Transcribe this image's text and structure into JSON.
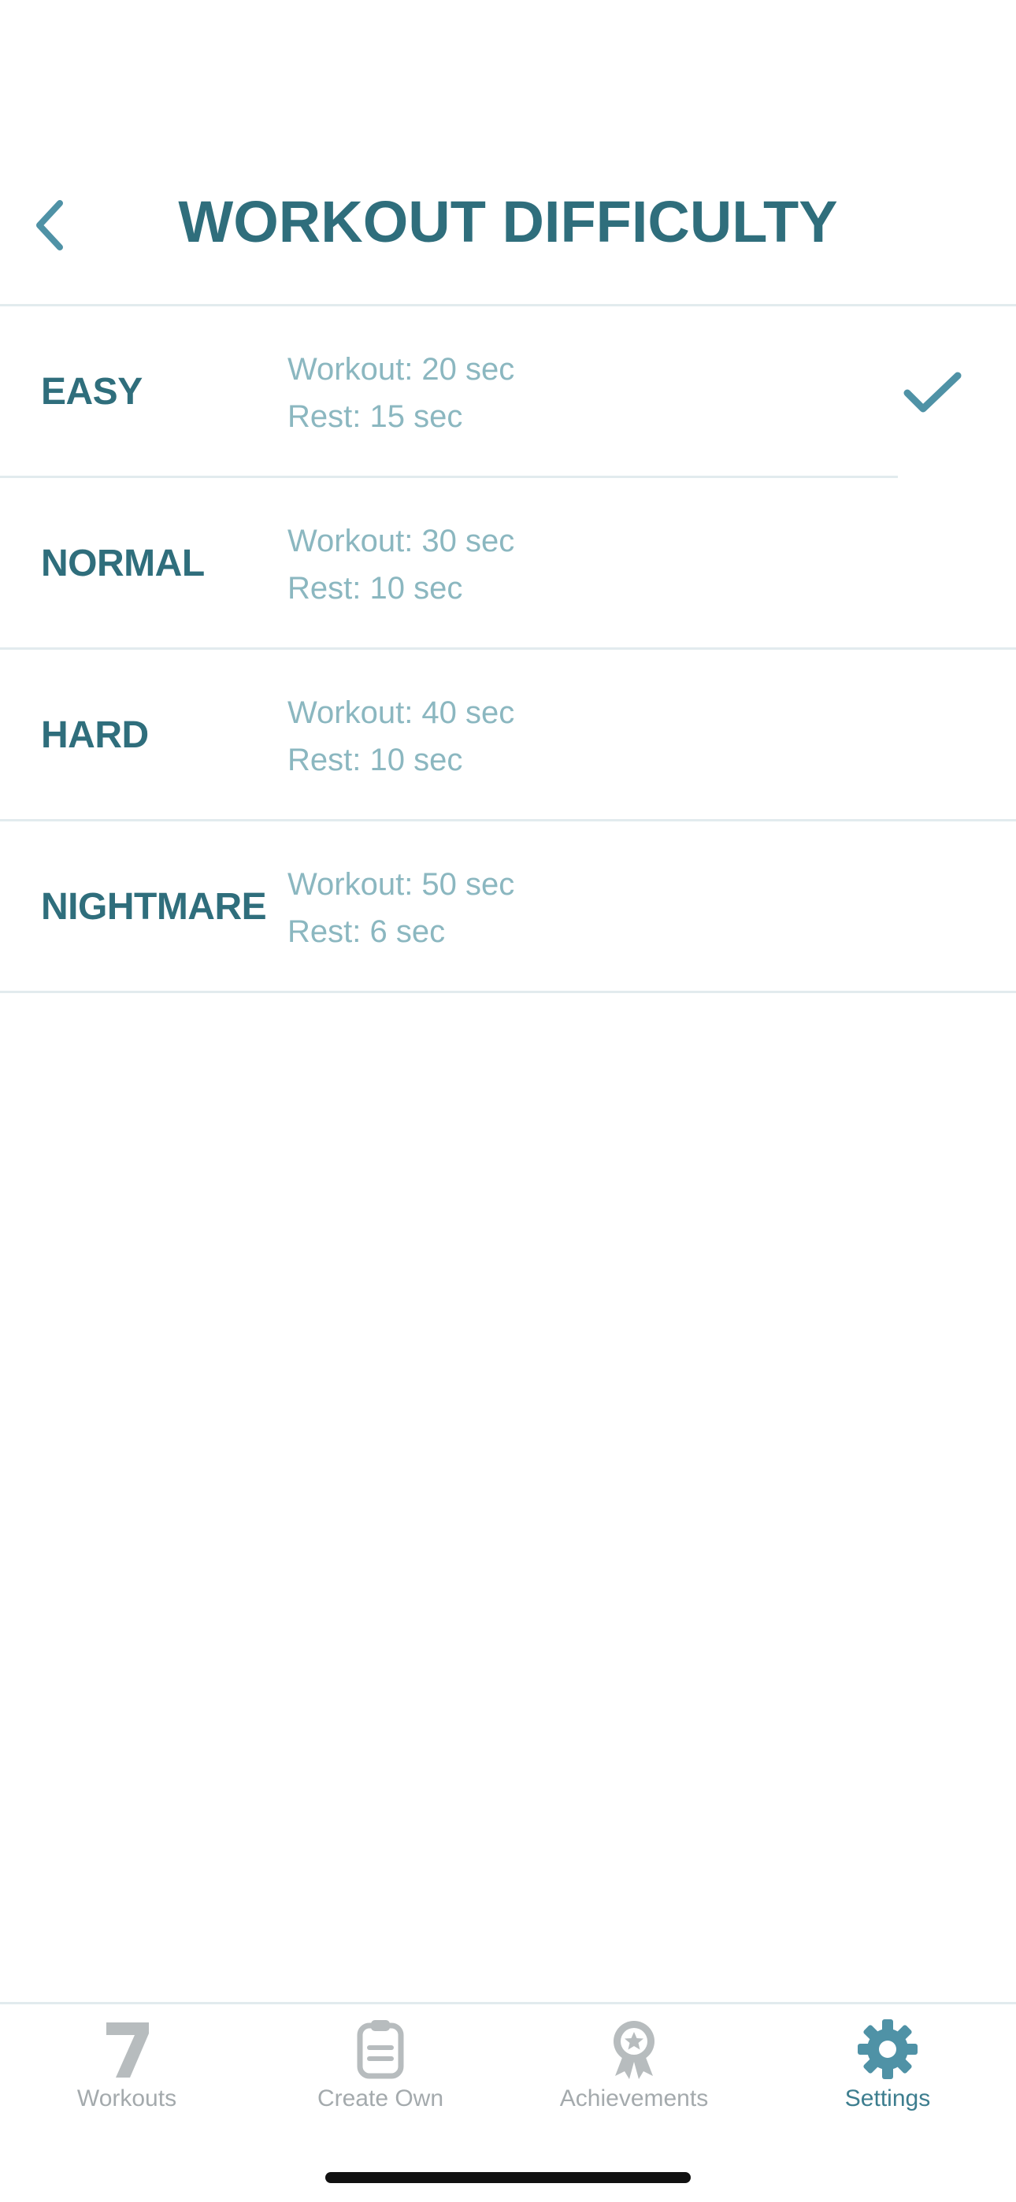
{
  "header": {
    "title": "WORKOUT DIFFICULTY",
    "back_icon": "chevron-left-icon"
  },
  "difficulties": [
    {
      "name": "EASY",
      "workout": "Workout: 20 sec",
      "rest": "Rest: 15 sec",
      "selected": true
    },
    {
      "name": "NORMAL",
      "workout": "Workout: 30 sec",
      "rest": "Rest: 10 sec",
      "selected": false
    },
    {
      "name": "HARD",
      "workout": "Workout: 40 sec",
      "rest": "Rest: 10 sec",
      "selected": false
    },
    {
      "name": "NIGHTMARE",
      "workout": "Workout: 50 sec",
      "rest": "Rest: 6 sec",
      "selected": false
    }
  ],
  "tab_bar": {
    "tabs": [
      {
        "label": "Workouts",
        "icon": "seven-icon",
        "active": false
      },
      {
        "label": "Create Own",
        "icon": "clipboard-icon",
        "active": false
      },
      {
        "label": "Achievements",
        "icon": "award-badge-icon",
        "active": false
      },
      {
        "label": "Settings",
        "icon": "gear-icon",
        "active": true
      }
    ]
  },
  "colors": {
    "title": "#2f6e7c",
    "detail_text": "#8bb7c0",
    "accent": "#4f92a6",
    "inactive_tab": "#b7bcbe",
    "divider": "#e2ebee"
  }
}
